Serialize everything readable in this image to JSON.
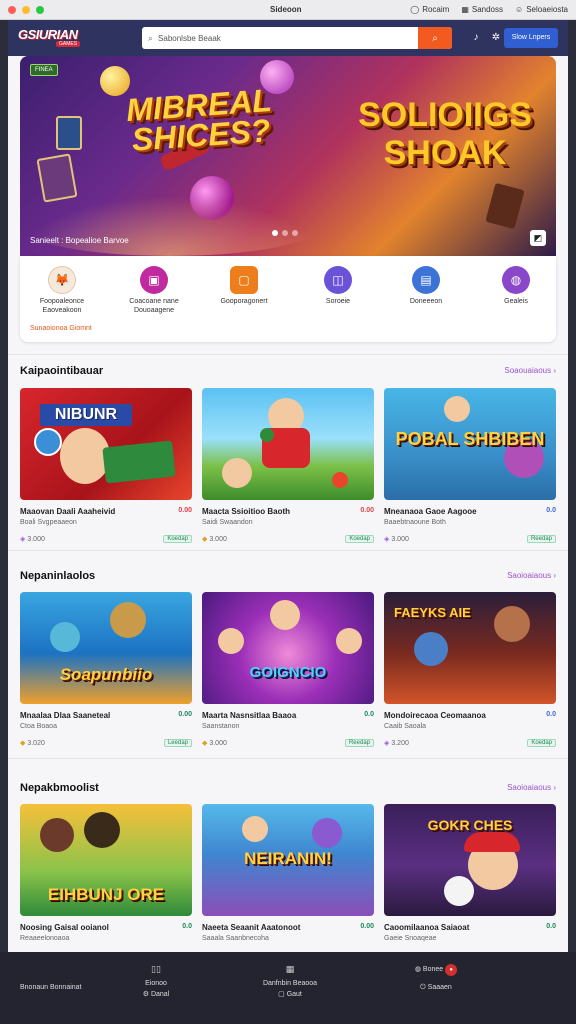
{
  "window": {
    "title": "Sideoon",
    "menu": [
      "Rocaim",
      "Sandoss",
      "Seloaeiosta"
    ],
    "dot_colors": [
      "#ff5f57",
      "#febc2e",
      "#28c840"
    ]
  },
  "appbar": {
    "logo": "GSIURIAN",
    "logo_sub": "GAMES",
    "search_placeholder": "Sabonlsbe Beaak",
    "signin_label": "Slow Lnpers"
  },
  "hero": {
    "tag": "FINEA",
    "left_title": "MIBREAL SHICES?",
    "right_title": "SOLIOIIGS SHOAK",
    "caption": "Sanieelt : Bopealioe Barvoe",
    "slides": 3,
    "active_slide": 0
  },
  "categories": [
    {
      "label": "Foopoaleonce\nEaoveakoon",
      "color": "#f5e9dc",
      "icon": "gift-icon",
      "glyph": "🦊"
    },
    {
      "label": "Coacoane nane\nDouoaagene",
      "color": "#c02aa0",
      "icon": "gamepad-icon",
      "glyph": "▣"
    },
    {
      "label": "Gooporagonert",
      "color": "#ee7d1b",
      "icon": "store-icon",
      "glyph": "▢"
    },
    {
      "label": "Soroeie",
      "color": "#6b53d9",
      "icon": "puzzle-icon",
      "glyph": "◫"
    },
    {
      "label": "Doneeeon",
      "color": "#3d72d6",
      "icon": "book-icon",
      "glyph": "▤"
    },
    {
      "label": "Gealeis",
      "color": "#8a47c9",
      "icon": "globe-icon",
      "glyph": "◍"
    }
  ],
  "categories_promo": "Sunaoionoa Giomnt",
  "sections": [
    {
      "title": "Kaipaointibauar",
      "more": "Soaouaiaous",
      "cards": [
        {
          "name": "Maaovan Daali Aaaheivid",
          "dev": "Boali Svgpeaaeon",
          "score": "0.00",
          "players": "3.000",
          "pill": "Koedap",
          "art": "NIBUNR",
          "bg": "linear-gradient(135deg,#d8262d,#a8131a 60%,#e8452c)"
        },
        {
          "name": "Maacta Ssioitioo Baoth",
          "dev": "Saidi Swaandon",
          "score": "0.00",
          "players": "3.000",
          "pill": "Koedap",
          "art": "",
          "bg": "linear-gradient(180deg,#5cc1f2,#9ae0fb 45%,#7cc047 70%,#3d8c2c)"
        },
        {
          "name": "Mneanaoa Gaoe Aagooe",
          "dev": "Baaebtnaoune Both",
          "score": "0.0",
          "players": "3.000",
          "pill": "Reedap",
          "art": "POBAL SHBIBEN",
          "bg": "linear-gradient(180deg,#48b6e6,#3a8fc9 60%,#2a6ea8)"
        }
      ]
    },
    {
      "title": "Nepaninlaolos",
      "more": "Saoioaiaous",
      "cards": [
        {
          "name": "Mnaalaa Dlaa Saaneteal",
          "dev": "Ctoa Boaoa",
          "score": "0.00",
          "players": "3.020",
          "pill": "Leedap",
          "art": "Soapunbiio",
          "bg": "linear-gradient(180deg,#3aa6e0,#1c72c2 55%,#f0a02a)"
        },
        {
          "name": "Maarta Nasnsitlaa Baaoa",
          "dev": "Saanstanon",
          "score": "0.0",
          "players": "3.000",
          "pill": "Reedap",
          "art": "GOIGNCIO",
          "bg": "radial-gradient(circle at 50% 55%,#f08ad8,#9b2fb8 45%,#4a1a7e)"
        },
        {
          "name": "Mondoirecaoa Ceomaanoa",
          "dev": "Caaib Saoala",
          "score": "0.0",
          "players": "3.200",
          "pill": "Koedap",
          "art": "FAEYKS AIE",
          "bg": "linear-gradient(180deg,#2a1e3a,#7a2a1f 55%,#d2542a)"
        }
      ]
    },
    {
      "title": "Nepakbmoolist",
      "more": "Saoioaiaous",
      "cards": [
        {
          "name": "Noosing Gaisal ooianol",
          "dev": "Reaaeelonoaoa",
          "score": "0.0",
          "players": "",
          "pill": "",
          "art": "EIHBUNJ ORE",
          "bg": "linear-gradient(180deg,#f6c03a,#8bc34a 60%,#2f8a3a)"
        },
        {
          "name": "Naeeta Seaanit Aaatonoot",
          "dev": "Saaala Saanbnecoha",
          "score": "0.00",
          "players": "",
          "pill": "",
          "art": "NEIRANIN!",
          "bg": "linear-gradient(180deg,#55b8ea,#3f86d0 45%,#8b4fb8)"
        },
        {
          "name": "Caoomilaanoa Saiaoat",
          "dev": "Gaeie Snoaqeae",
          "score": "0.0",
          "players": "",
          "pill": "",
          "art": "GOKR CHES",
          "bg": "linear-gradient(180deg,#3a1f5a,#5a2f82 55%,#2a1a3e)"
        }
      ]
    }
  ],
  "footer": {
    "left_label": "Bnonaun Bonnainat",
    "col2": [
      "Eionoo",
      "Danal"
    ],
    "col3": [
      "Danfnbin Beaooa",
      "Gaut"
    ],
    "col4": [
      "Bonee",
      "Saaaen"
    ]
  }
}
